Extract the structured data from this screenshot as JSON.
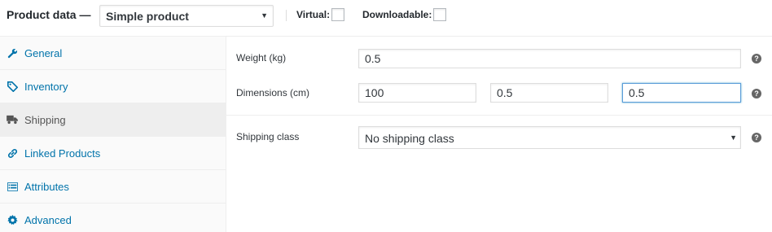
{
  "header": {
    "title": "Product data —",
    "product_type": "Simple product",
    "virtual_label": "Virtual:",
    "downloadable_label": "Downloadable:",
    "virtual_checked": false,
    "downloadable_checked": false
  },
  "tabs": [
    {
      "label": "General",
      "icon": "wrench-icon",
      "active": false
    },
    {
      "label": "Inventory",
      "icon": "tag-icon",
      "active": false
    },
    {
      "label": "Shipping",
      "icon": "truck-icon",
      "active": true
    },
    {
      "label": "Linked Products",
      "icon": "link-icon",
      "active": false
    },
    {
      "label": "Attributes",
      "icon": "list-icon",
      "active": false
    },
    {
      "label": "Advanced",
      "icon": "gear-icon",
      "active": false
    }
  ],
  "shipping": {
    "weight_label": "Weight (kg)",
    "weight_value": "0.5",
    "dimensions_label": "Dimensions (cm)",
    "length_value": "100",
    "width_value": "0.5",
    "height_value": "0.5",
    "class_label": "Shipping class",
    "class_value": "No shipping class",
    "help_glyph": "?"
  },
  "colors": {
    "link": "#0073aa",
    "active_tab_bg": "#eeeeee",
    "focus_border": "#5b9dd9"
  }
}
